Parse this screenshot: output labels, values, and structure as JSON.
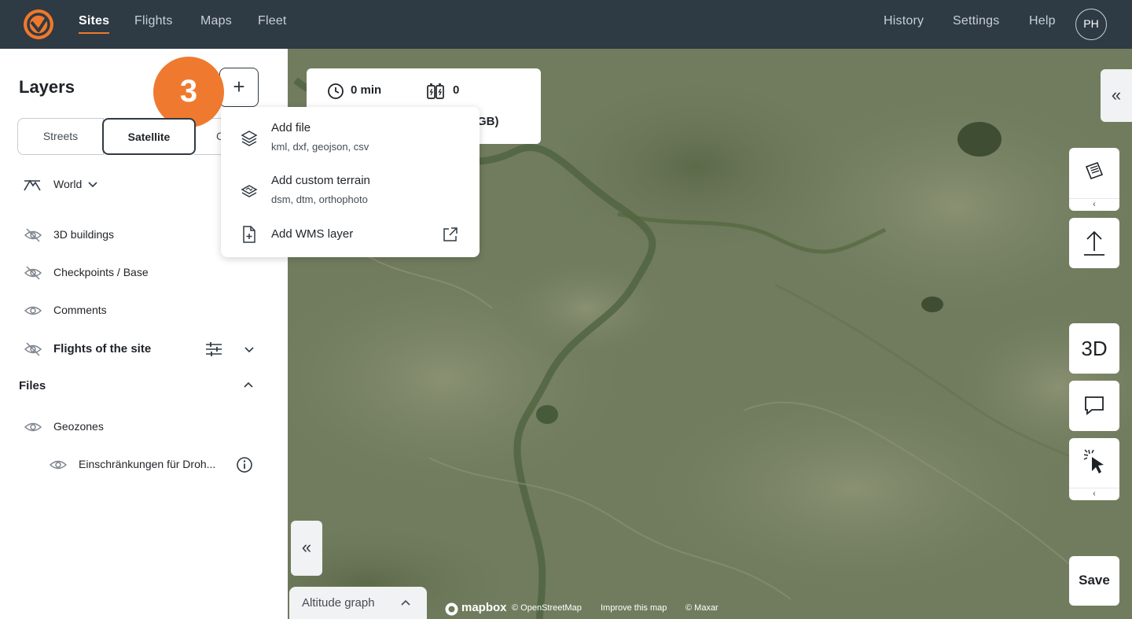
{
  "nav": {
    "items": [
      "Sites",
      "Flights",
      "Maps",
      "Fleet"
    ],
    "right_items": [
      "History",
      "Settings",
      "Help"
    ],
    "avatar_initials": "PH",
    "active": "Sites"
  },
  "sidebar": {
    "title": "Layers",
    "step_badge": "3",
    "add_label": "+",
    "basemaps": [
      "Streets",
      "Satellite",
      "C"
    ],
    "selected_basemap": "Satellite",
    "terrain": "World",
    "layers": [
      {
        "label": "3D buildings",
        "visible": false
      },
      {
        "label": "Checkpoints / Base",
        "visible": false
      },
      {
        "label": "Comments",
        "visible": true
      },
      {
        "label": "Flights of the site",
        "visible": false
      }
    ],
    "files_title": "Files",
    "files": [
      {
        "label": "Geozones",
        "visible": true
      },
      {
        "label": "Einschränkungen für Droh...",
        "visible": true
      }
    ]
  },
  "stats": {
    "time": "0 min",
    "batteries": "0",
    "size_fragment": "GB)"
  },
  "add_menu": {
    "items": [
      {
        "title": "Add file",
        "subtitle": "kml, dxf, geojson, csv"
      },
      {
        "title": "Add custom terrain",
        "subtitle": "dsm, dtm, orthophoto"
      },
      {
        "title": "Add WMS layer",
        "subtitle": ""
      }
    ]
  },
  "map": {
    "collapse_right": "«",
    "collapse_left": "«",
    "altitude_graph": "Altitude graph",
    "tool_3d": "3D",
    "save": "Save",
    "tool_sub_arrow": "‹",
    "mapbox": "mapbox",
    "attributions": [
      "© OpenStreetMap",
      "Improve this map",
      "© Maxar"
    ]
  },
  "colors": {
    "topbar": "#2e3a44",
    "accent": "#f0782a",
    "map_base": "#6e7a5b"
  }
}
